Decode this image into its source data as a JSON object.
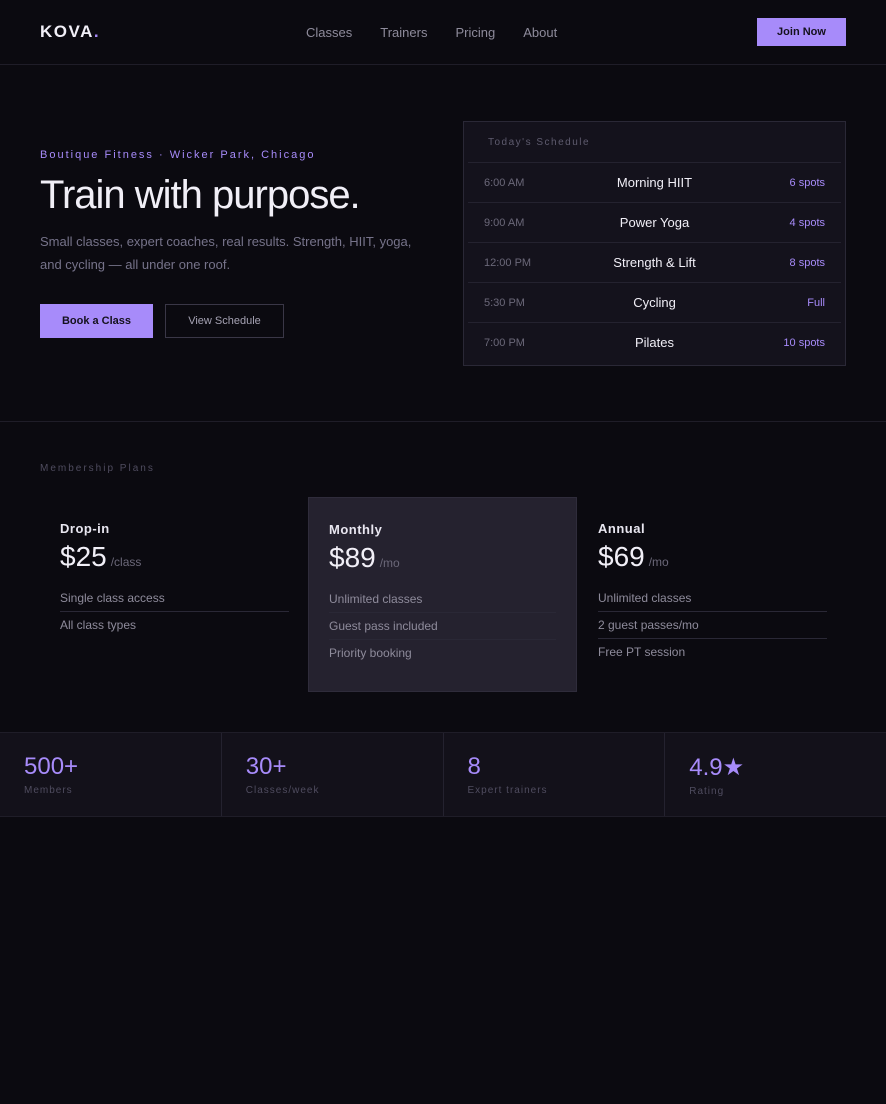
{
  "nav": {
    "logo": "KOVA",
    "logo_dot": ".",
    "links": [
      "Classes",
      "Trainers",
      "Pricing",
      "About"
    ],
    "cta": "Join Now"
  },
  "hero": {
    "eyebrow": "Boutique Fitness · Wicker Park, Chicago",
    "title": "Train with purpose.",
    "subtitle": "Small classes, expert coaches, real results. Strength, HIIT, yoga, and cycling — all under one roof.",
    "primary_cta": "Book a Class",
    "secondary_cta": "View Schedule"
  },
  "schedule": {
    "title": "Today's Schedule",
    "rows": [
      {
        "time": "6:00 AM",
        "name": "Morning HIIT",
        "spots": "6 spots"
      },
      {
        "time": "9:00 AM",
        "name": "Power Yoga",
        "spots": "4 spots"
      },
      {
        "time": "12:00 PM",
        "name": "Strength & Lift",
        "spots": "8 spots"
      },
      {
        "time": "5:30 PM",
        "name": "Cycling",
        "spots": "Full"
      },
      {
        "time": "7:00 PM",
        "name": "Pilates",
        "spots": "10 spots"
      }
    ]
  },
  "plans": {
    "title": "Membership Plans",
    "items": [
      {
        "name": "Drop-in",
        "price": "$25",
        "unit": "/class",
        "features": [
          "Single class access",
          "All class types"
        ]
      },
      {
        "name": "Monthly",
        "price": "$89",
        "unit": "/mo",
        "features": [
          "Unlimited classes",
          "Guest pass included",
          "Priority booking"
        ]
      },
      {
        "name": "Annual",
        "price": "$69",
        "unit": "/mo",
        "features": [
          "Unlimited classes",
          "2 guest passes/mo",
          "Free PT session"
        ]
      }
    ]
  },
  "stats": [
    {
      "value": "500+",
      "label": "Members"
    },
    {
      "value": "30+",
      "label": "Classes/week"
    },
    {
      "value": "8",
      "label": "Expert trainers"
    },
    {
      "value": "4.9★",
      "label": "Rating"
    }
  ],
  "colors": {
    "accent": "#a78bfa",
    "background": "#0b0a10",
    "card": "#14121c",
    "featured_card": "#25222f"
  }
}
